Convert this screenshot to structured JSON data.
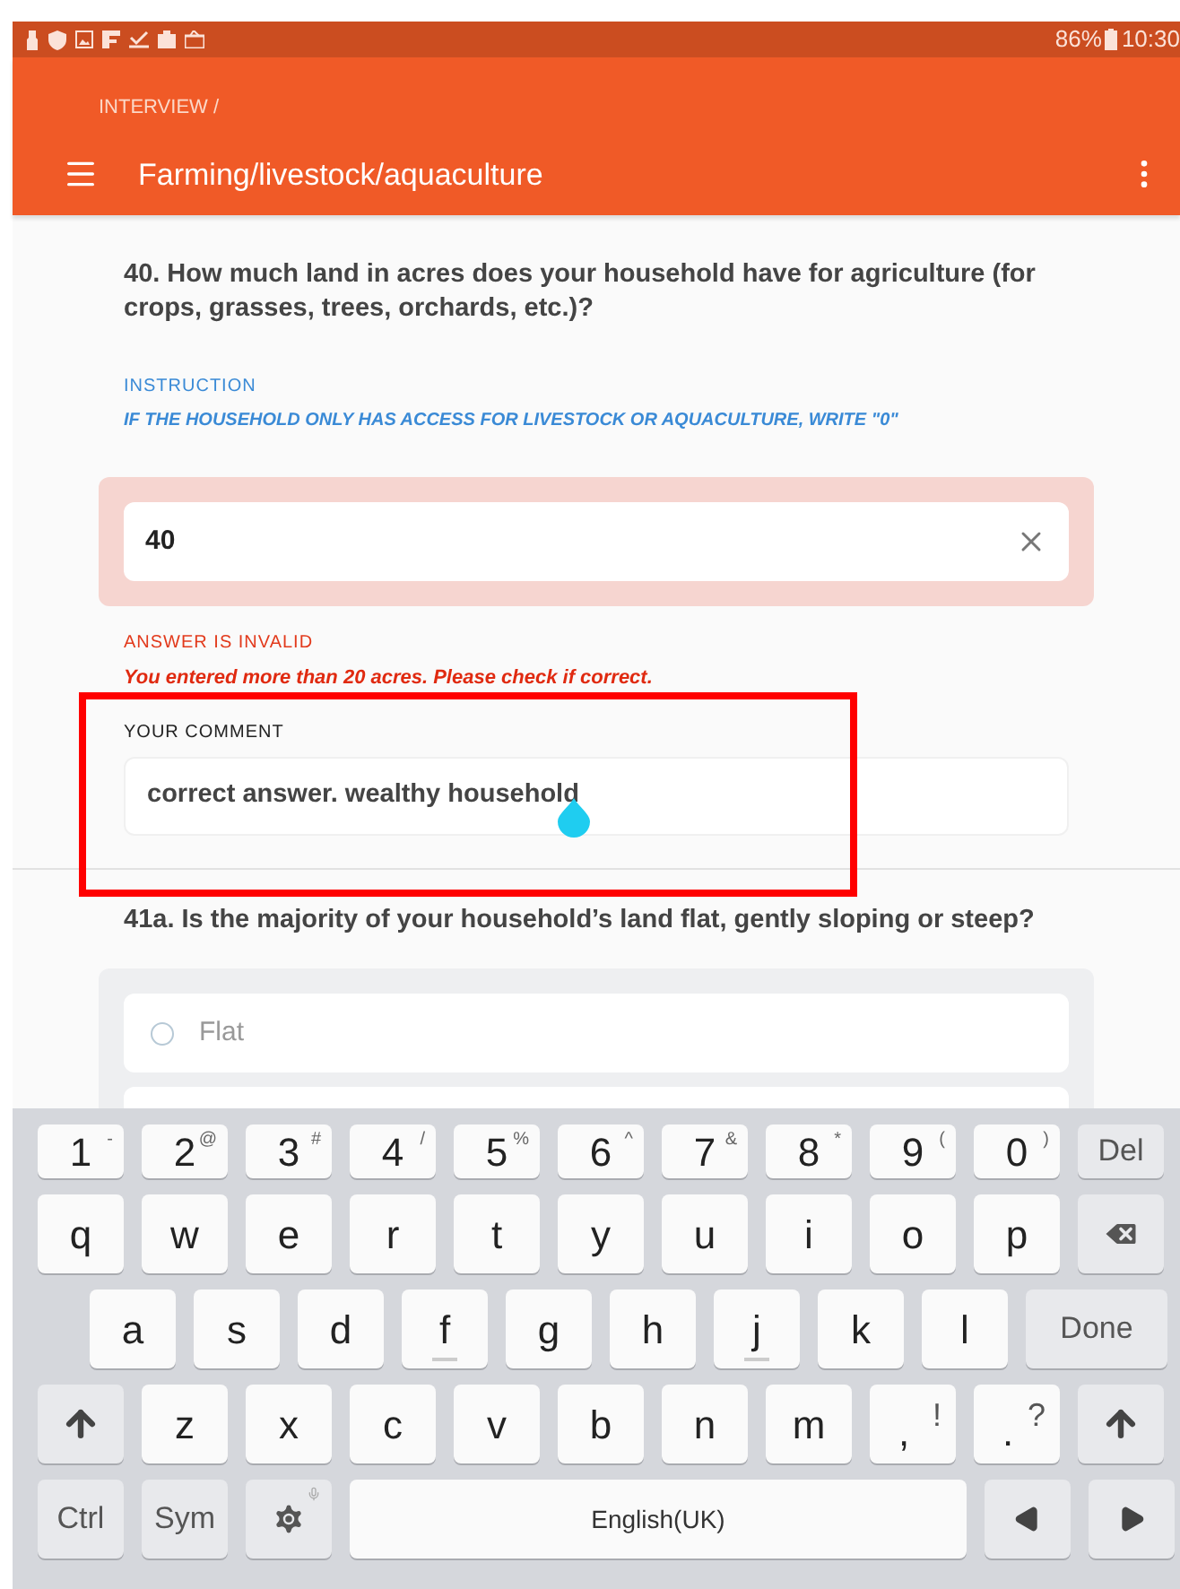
{
  "status_bar": {
    "battery": "86%",
    "time": "10:30"
  },
  "app_bar": {
    "breadcrumb": "INTERVIEW /",
    "title": "Farming/livestock/aquaculture"
  },
  "questions": [
    {
      "kind": "numeric",
      "title": "40. How much land in acres does your household have for agriculture (for crops, grasses, trees, orchards, etc.)?",
      "instruction_label": "INSTRUCTION",
      "instruction": "IF THE HOUSEHOLD ONLY HAS ACCESS FOR LIVESTOCK OR AQUACULTURE, WRITE \"0\"",
      "answer": "40",
      "invalid": true,
      "error_label": "ANSWER IS INVALID",
      "error": "You entered more than 20 acres. Please check if correct.",
      "comment_label": "YOUR COMMENT",
      "comment": "correct answer. wealthy household"
    },
    {
      "kind": "single_choice",
      "title": "41a. Is the majority of your household’s land flat, gently sloping or steep?",
      "options": [
        {
          "label": "Flat",
          "selected": false
        }
      ]
    }
  ],
  "keyboard": {
    "rows": [
      {
        "keys": [
          {
            "kind": "char",
            "main": "1",
            "alt": "-"
          },
          {
            "kind": "char",
            "main": "2",
            "alt": "@"
          },
          {
            "kind": "char",
            "main": "3",
            "alt": "#"
          },
          {
            "kind": "char",
            "main": "4",
            "alt": "/"
          },
          {
            "kind": "char",
            "main": "5",
            "alt": "%"
          },
          {
            "kind": "char",
            "main": "6",
            "alt": "^"
          },
          {
            "kind": "char",
            "main": "7",
            "alt": "&"
          },
          {
            "kind": "char",
            "main": "8",
            "alt": "*"
          },
          {
            "kind": "char",
            "main": "9",
            "alt": "("
          },
          {
            "kind": "char",
            "main": "0",
            "alt": ")"
          },
          {
            "kind": "special",
            "main": "Del"
          }
        ]
      },
      {
        "keys": [
          {
            "kind": "char",
            "main": "q"
          },
          {
            "kind": "char",
            "main": "w"
          },
          {
            "kind": "char",
            "main": "e"
          },
          {
            "kind": "char",
            "main": "r"
          },
          {
            "kind": "char",
            "main": "t"
          },
          {
            "kind": "char",
            "main": "y"
          },
          {
            "kind": "char",
            "main": "u"
          },
          {
            "kind": "char",
            "main": "i"
          },
          {
            "kind": "char",
            "main": "o"
          },
          {
            "kind": "char",
            "main": "p"
          },
          {
            "kind": "backspace"
          }
        ]
      },
      {
        "keys": [
          {
            "kind": "char",
            "main": "a"
          },
          {
            "kind": "char",
            "main": "s"
          },
          {
            "kind": "char",
            "main": "d"
          },
          {
            "kind": "char",
            "main": "f",
            "home": true
          },
          {
            "kind": "char",
            "main": "g"
          },
          {
            "kind": "char",
            "main": "h"
          },
          {
            "kind": "char",
            "main": "j",
            "home": true
          },
          {
            "kind": "char",
            "main": "k"
          },
          {
            "kind": "char",
            "main": "l"
          },
          {
            "kind": "done",
            "main": "Done"
          }
        ]
      },
      {
        "keys": [
          {
            "kind": "shift"
          },
          {
            "kind": "char",
            "main": "z"
          },
          {
            "kind": "char",
            "main": "x"
          },
          {
            "kind": "char",
            "main": "c"
          },
          {
            "kind": "char",
            "main": "v"
          },
          {
            "kind": "char",
            "main": "b"
          },
          {
            "kind": "char",
            "main": "n"
          },
          {
            "kind": "char",
            "main": "m"
          },
          {
            "kind": "punct",
            "main": ",",
            "alt": "!"
          },
          {
            "kind": "punct",
            "main": ".",
            "alt": "?"
          },
          {
            "kind": "shift"
          }
        ]
      },
      {
        "keys": [
          {
            "kind": "special",
            "main": "Ctrl"
          },
          {
            "kind": "special",
            "main": "Sym"
          },
          {
            "kind": "settings"
          },
          {
            "kind": "space",
            "main": "English(UK)"
          },
          {
            "kind": "left"
          },
          {
            "kind": "right"
          }
        ]
      }
    ]
  }
}
